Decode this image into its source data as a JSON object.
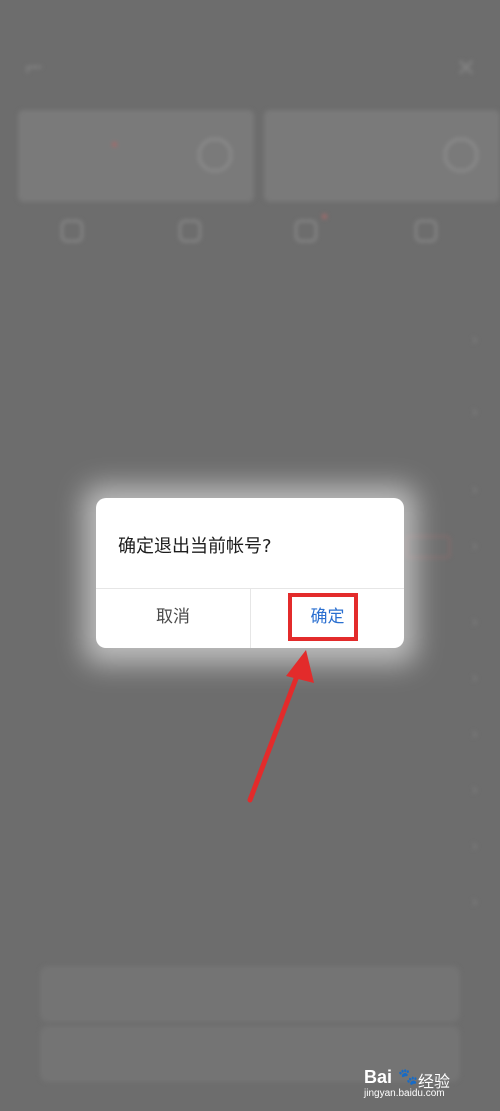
{
  "dialog": {
    "message": "确定退出当前帐号?",
    "cancel_label": "取消",
    "confirm_label": "确定"
  },
  "watermark": {
    "brand": "Bai",
    "brand_cn": "经验",
    "url": "jingyan.baidu.com"
  },
  "colors": {
    "overlay": "#6d6d6d",
    "dialog_bg": "#ffffff",
    "confirm_text": "#2a6fd0",
    "highlight": "#e32b2b"
  },
  "background": {
    "icons": [
      "scan-icon",
      "close-icon",
      "shield-icon",
      "power-icon"
    ]
  }
}
